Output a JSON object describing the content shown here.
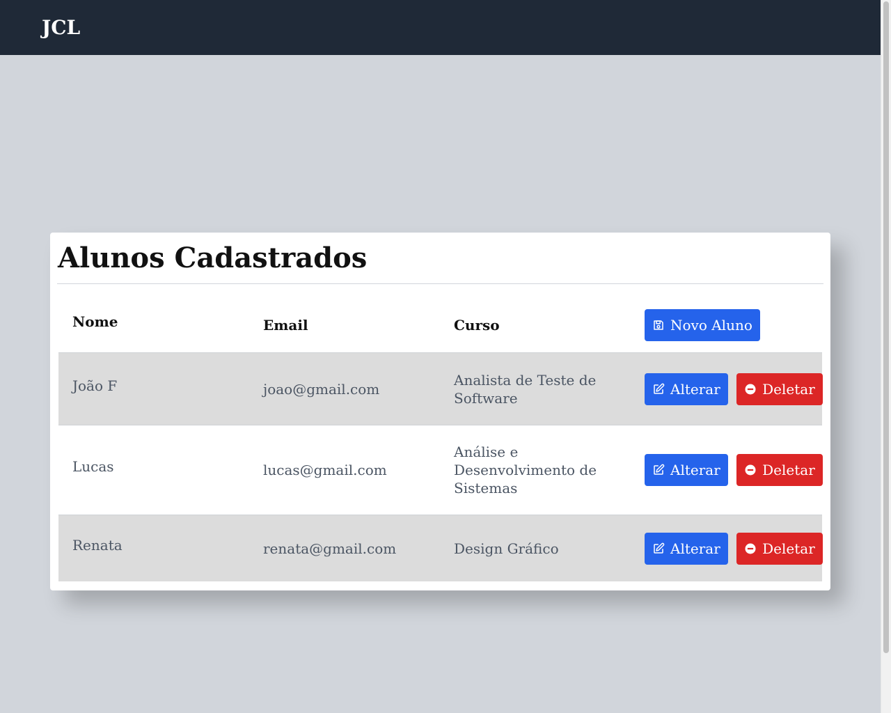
{
  "navbar": {
    "brand": "JCL"
  },
  "page": {
    "title": "Alunos Cadastrados"
  },
  "table": {
    "headers": {
      "nome": "Nome",
      "email": "Email",
      "curso": "Curso"
    },
    "new_button_label": "Novo Aluno",
    "edit_label": "Alterar",
    "delete_label": "Deletar",
    "rows": [
      {
        "nome": "João F",
        "email": "joao@gmail.com",
        "curso": "Analista de Teste de Software"
      },
      {
        "nome": "Lucas",
        "email": "lucas@gmail.com",
        "curso": "Análise e Desenvolvimento de Sistemas"
      },
      {
        "nome": "Renata",
        "email": "renata@gmail.com",
        "curso": "Design Gráfico"
      }
    ]
  },
  "icons": {
    "new": "save-icon",
    "edit": "edit-icon",
    "delete": "minus-circle-icon"
  },
  "colors": {
    "navbar": "#1f2937",
    "primary": "#2563eb",
    "danger": "#dc2626",
    "background": "#d1d5db"
  }
}
